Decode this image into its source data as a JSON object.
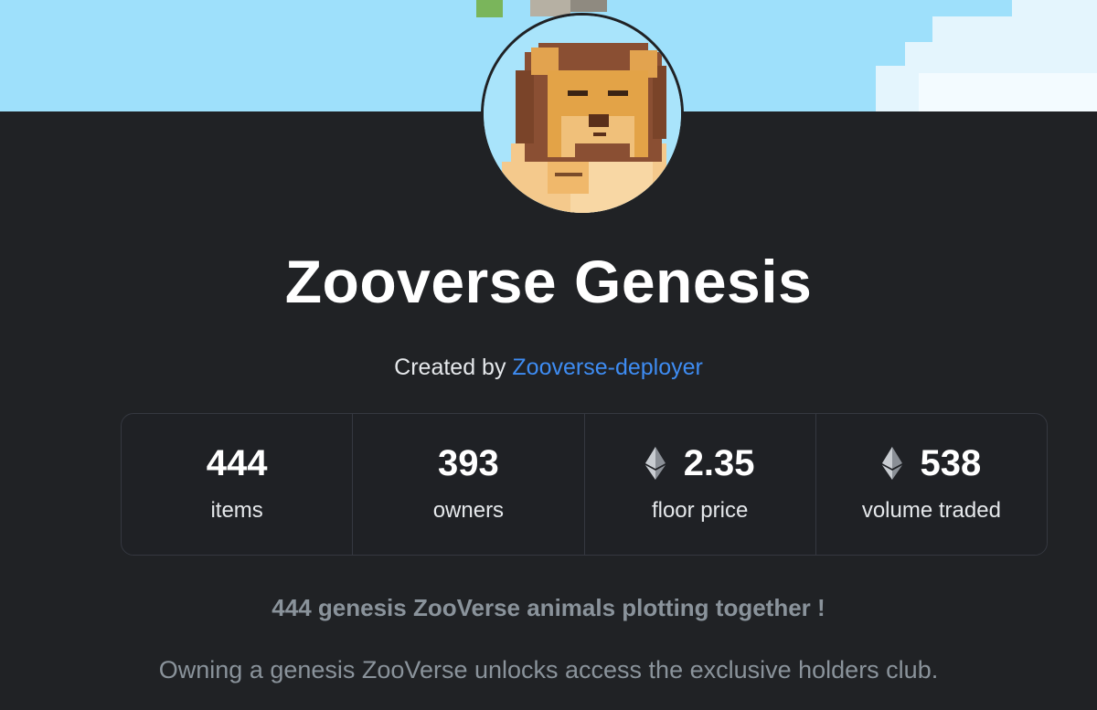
{
  "collection": {
    "name": "Zooverse Genesis",
    "created_by_prefix": "Created by",
    "creator": "Zooverse-deployer"
  },
  "stats": [
    {
      "value": "444",
      "label": "items",
      "icon": null
    },
    {
      "value": "393",
      "label": "owners",
      "icon": null
    },
    {
      "value": "2.35",
      "label": "floor price",
      "icon": "ethereum-icon"
    },
    {
      "value": "538",
      "label": "volume traded",
      "icon": "ethereum-icon"
    }
  ],
  "description": {
    "headline": "444 genesis ZooVerse animals plotting together !",
    "body": "Owning a genesis ZooVerse unlocks access the exclusive holders club."
  },
  "colors": {
    "background": "#202225",
    "banner_sky": "#9ee0fb",
    "link": "#3e8cf2",
    "muted_text": "#8a939b"
  }
}
